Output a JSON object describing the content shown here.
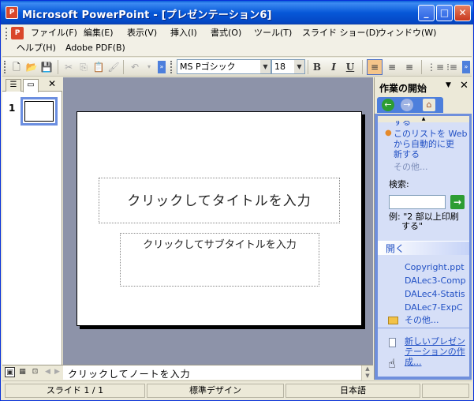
{
  "window": {
    "title": "Microsoft PowerPoint - [プレゼンテーション6]",
    "app_icon": "P",
    "min_icon": "_",
    "max_icon": "□",
    "close_icon": "✕"
  },
  "menu": {
    "items": [
      "ファイル(F)",
      "編集(E)",
      "表示(V)",
      "挿入(I)",
      "書式(O)",
      "ツール(T)",
      "スライド ショー(D)",
      "ウィンドウ(W)",
      "ヘルプ(H)",
      "Adobe PDF(B)"
    ]
  },
  "toolbar": {
    "font_name": "MS Pゴシック",
    "font_size": "18",
    "bold": "B",
    "italic": "I",
    "underline": "U"
  },
  "slides_pane": {
    "slide_number": "1",
    "close": "✕"
  },
  "slide": {
    "title_placeholder": "クリックしてタイトルを入力",
    "subtitle_placeholder": "クリックしてサブタイトルを入力"
  },
  "notes": {
    "placeholder": "クリックしてノートを入力"
  },
  "taskpane": {
    "title": "作業の開始",
    "close": "✕",
    "dropdown": "▼",
    "nav": {
      "back": "←",
      "forward": "→",
      "home": "⌂"
    },
    "partial_top": "する",
    "bullet_link": [
      "このリストを Web",
      "から自動的に更",
      "新する"
    ],
    "more_1": "その他...",
    "search_label": "検索:",
    "search_go": "→",
    "example": [
      "例: \"2 部以上印刷",
      "する\""
    ],
    "open_section": "開く",
    "recent_files": [
      "Copyright.ppt",
      "DALec3-Comp",
      "DALec4-Statis",
      "DALec7-ExpC"
    ],
    "more_2": "その他...",
    "new_presentation": [
      "新しいプレゼン",
      "テーションの作",
      "成..."
    ]
  },
  "status": {
    "slide": "スライド 1 / 1",
    "design": "標準デザイン",
    "language": "日本語"
  }
}
